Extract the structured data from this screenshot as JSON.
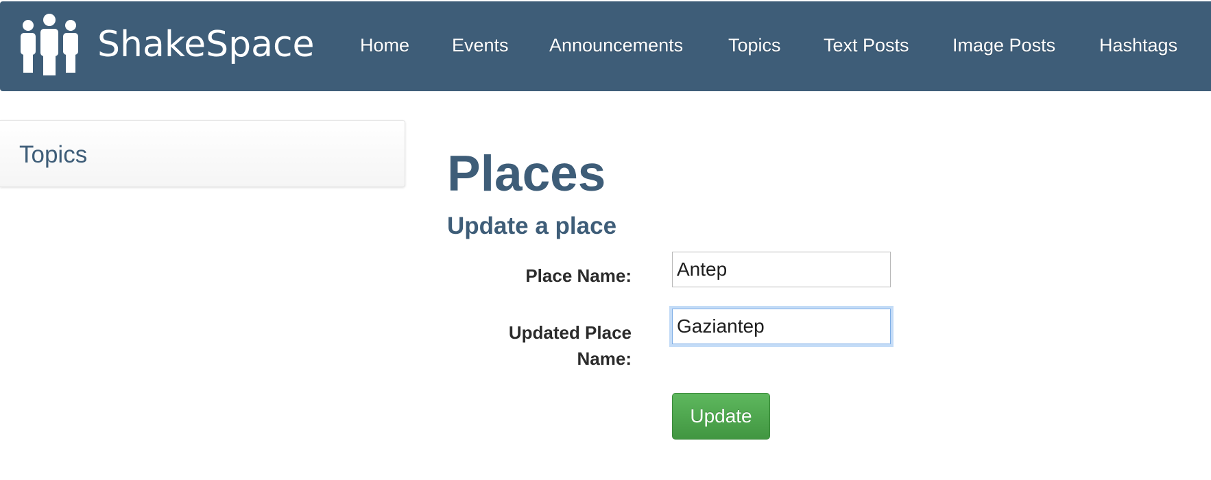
{
  "navbar": {
    "brand_name": "ShakeSpace",
    "logo_icon": "people-group-icon",
    "background_color": "#3e5d78",
    "links": [
      {
        "label": "Home"
      },
      {
        "label": "Events"
      },
      {
        "label": "Announcements"
      },
      {
        "label": "Topics"
      },
      {
        "label": "Text Posts"
      },
      {
        "label": "Image Posts"
      },
      {
        "label": "Hashtags"
      }
    ]
  },
  "sidebar": {
    "title": "Topics"
  },
  "main": {
    "page_title": "Places",
    "section_title": "Update a place",
    "form": {
      "place_name_label": "Place Name:",
      "place_name_value": "Antep",
      "updated_place_name_label": "Updated Place Name:",
      "updated_place_name_value": "Gaziantep",
      "submit_label": "Update",
      "submit_color": "#4cae4c"
    }
  }
}
